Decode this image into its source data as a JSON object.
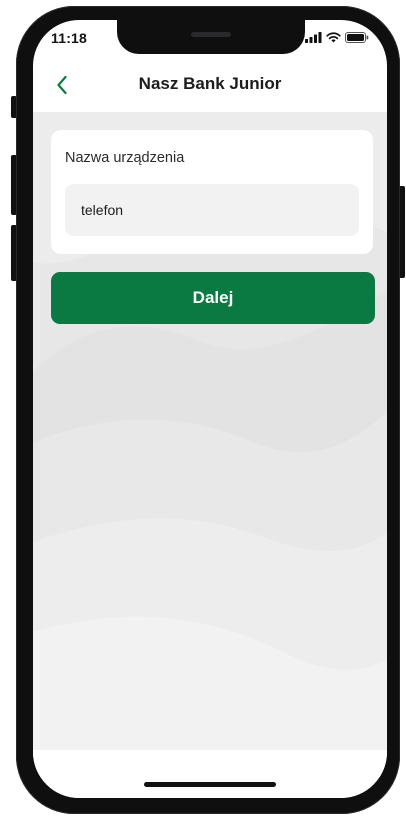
{
  "status_bar": {
    "time": "11:18",
    "icons": [
      "signal-icon",
      "wifi-icon",
      "battery-icon"
    ]
  },
  "header": {
    "back_icon": "chevron-left-icon",
    "title": "Nasz Bank Junior"
  },
  "form": {
    "label": "Nazwa urządzenia",
    "value": "telefon",
    "placeholder": ""
  },
  "actions": {
    "next_label": "Dalej"
  },
  "colors": {
    "primary_green": "#0b7a42",
    "back_arrow": "#0b7a42",
    "content_bg": "#e9e9e9"
  }
}
